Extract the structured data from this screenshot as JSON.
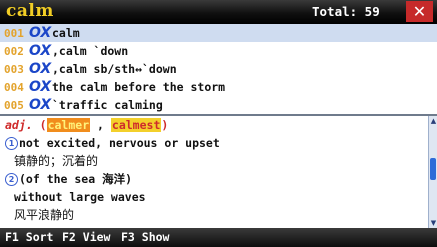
{
  "titlebar": {
    "search_text": "calm",
    "total": "Total: 59",
    "close": "✕"
  },
  "results": [
    {
      "num": "001",
      "tag": "OX",
      "text": "calm"
    },
    {
      "num": "002",
      "tag": "OX",
      "text": ",calm `down"
    },
    {
      "num": "003",
      "tag": "OX",
      "text": ",calm sb/sth↔`down"
    },
    {
      "num": "004",
      "tag": "OX",
      "text": "the calm before the storm"
    },
    {
      "num": "005",
      "tag": "OX",
      "text": "`traffic calming"
    }
  ],
  "definition": {
    "pos": "adj.",
    "open_paren": "(",
    "comparative": "calmer",
    "comma": " , ",
    "superlative": "calmest",
    "close_paren": ")",
    "sense1_marker": "1",
    "sense1_en": "not excited, nervous or upset",
    "sense1_cn": "镇静的；沉着的",
    "sense2_marker": "2",
    "sense2_label": "(of the sea 海洋)",
    "sense2_en": "without large waves",
    "sense2_cn": "风平浪静的"
  },
  "scrollbar": {
    "up": "▲",
    "down": "▼"
  },
  "bottombar": {
    "f1": "F1 Sort",
    "f2": "F2 View",
    "f3": "F3 Show"
  }
}
